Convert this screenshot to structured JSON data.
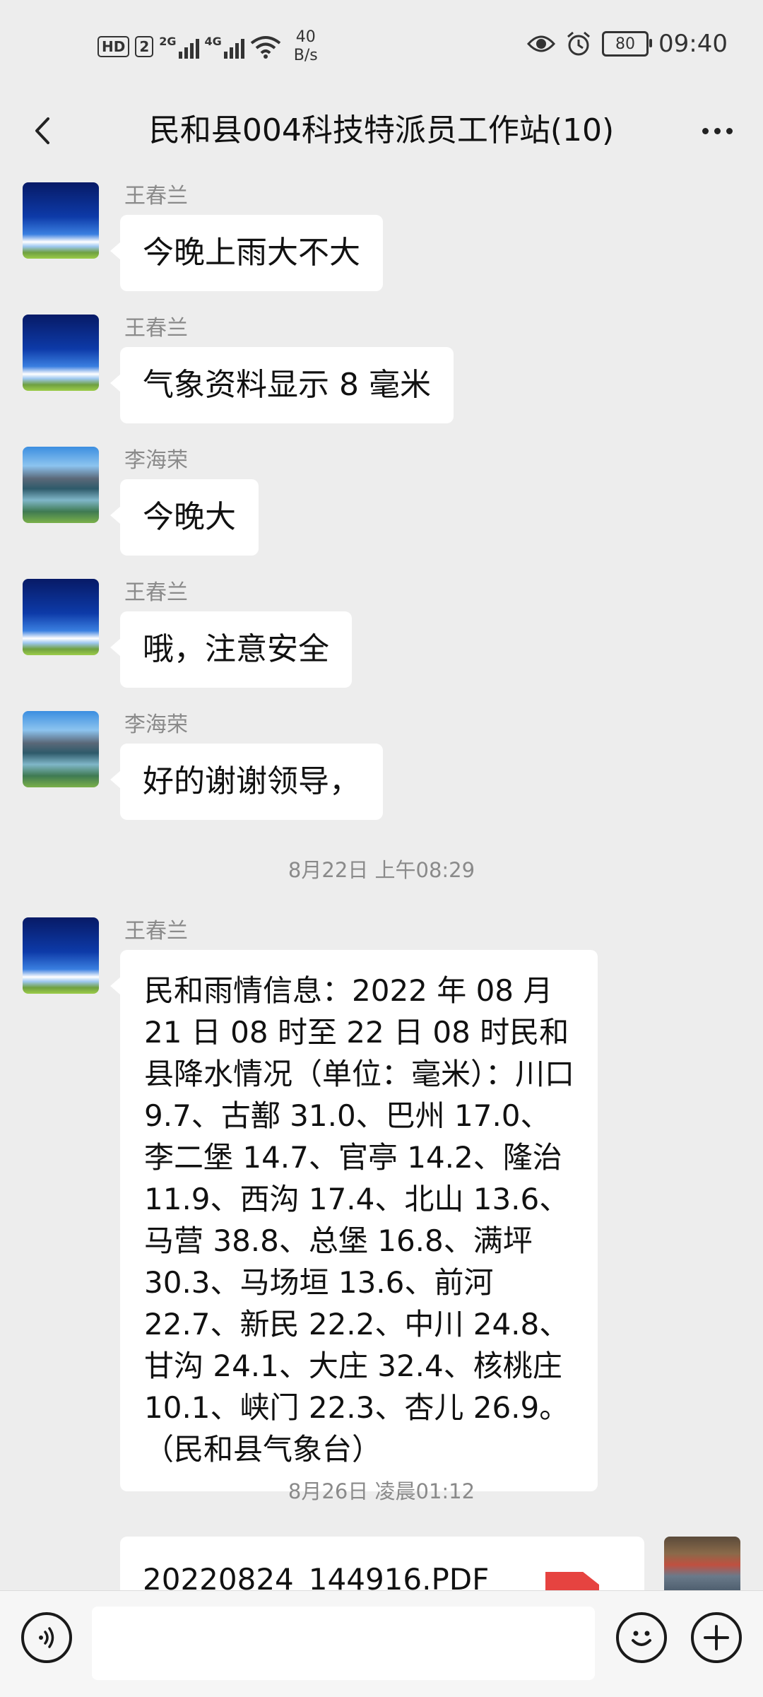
{
  "status_bar": {
    "hd_label": "HD",
    "sim_label": "2",
    "signal1_label": "2G",
    "signal2_label": "4G",
    "speed_value": "40",
    "speed_unit": "B/s",
    "battery": "80",
    "time": "09:40"
  },
  "header": {
    "title": "民和县004科技特派员工作站(10)"
  },
  "messages": [
    {
      "sender": "王春兰",
      "text": "今晚上雨大不大",
      "avatar": "sky"
    },
    {
      "sender": "王春兰",
      "text": "气象资料显示 8 毫米",
      "avatar": "sky"
    },
    {
      "sender": "李海荣",
      "text": "今晚大",
      "avatar": "lake"
    },
    {
      "sender": "王春兰",
      "text": "哦，注意安全",
      "avatar": "sky"
    },
    {
      "sender": "李海荣",
      "text": "好的谢谢领导，",
      "avatar": "lake"
    }
  ],
  "timestamps": [
    "8月22日 上午08:29",
    "8月26日 凌晨01:12"
  ],
  "long_message": {
    "sender": "王春兰",
    "text": "民和雨情信息：2022 年 08 月 21 日 08 时至 22 日 08 时民和县降水情况（单位：毫米）：川口 9.7、古鄯 31.0、巴州 17.0、李二堡 14.7、官亭 14.2、隆治 11.9、西沟 17.4、北山 13.6、马营 38.8、总堡 16.8、满坪 30.3、马场垣 13.6、前河 22.7、新民 22.2、中川 24.8、甘沟 24.1、大庄 32.4、核桃庄 10.1、峡门 22.3、杏儿 26.9。（民和县气象台）"
  },
  "file_message": {
    "filename": "20220824_144916.PDF",
    "icon": "pdf-file-icon"
  },
  "input_bar": {
    "voice_icon": "voice-icon",
    "emoji_icon": "emoji-icon",
    "plus_icon": "plus-icon"
  },
  "colors": {
    "background": "#ededed",
    "bubble": "#ffffff",
    "pdf_red": "#e64340"
  }
}
